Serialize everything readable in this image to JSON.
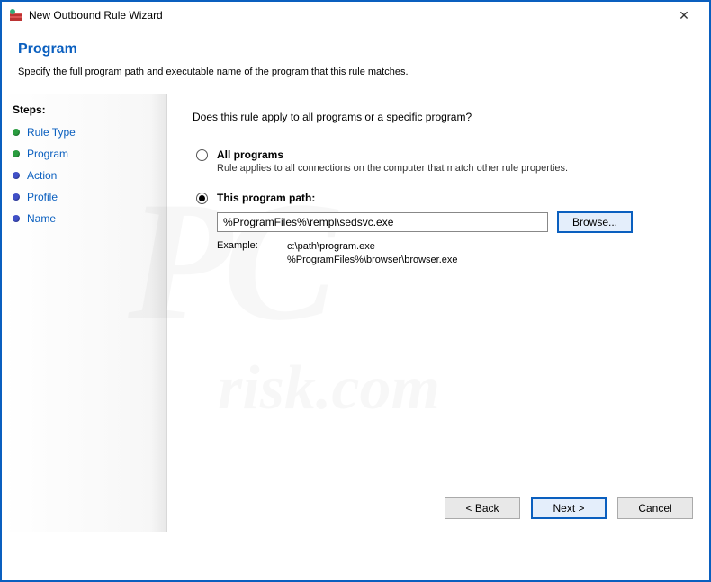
{
  "titlebar": {
    "title": "New Outbound Rule Wizard"
  },
  "header": {
    "heading": "Program",
    "subheading": "Specify the full program path and executable name of the program that this rule matches."
  },
  "sidebar": {
    "title": "Steps:",
    "items": [
      {
        "label": "Rule Type",
        "state": "done"
      },
      {
        "label": "Program",
        "state": "done"
      },
      {
        "label": "Action",
        "state": "pending"
      },
      {
        "label": "Profile",
        "state": "pending"
      },
      {
        "label": "Name",
        "state": "pending"
      }
    ]
  },
  "main": {
    "question": "Does this rule apply to all programs or a specific program?",
    "option_all": {
      "label": "All programs",
      "sub": "Rule applies to all connections on the computer that match other rule properties.",
      "checked": false
    },
    "option_path": {
      "label": "This program path:",
      "checked": true,
      "value": "%ProgramFiles%\\rempl\\sedsvc.exe",
      "browse": "Browse...",
      "example_label": "Example:",
      "example_line1": "c:\\path\\program.exe",
      "example_line2": "%ProgramFiles%\\browser\\browser.exe"
    }
  },
  "buttons": {
    "back": "< Back",
    "next": "Next >",
    "cancel": "Cancel"
  }
}
